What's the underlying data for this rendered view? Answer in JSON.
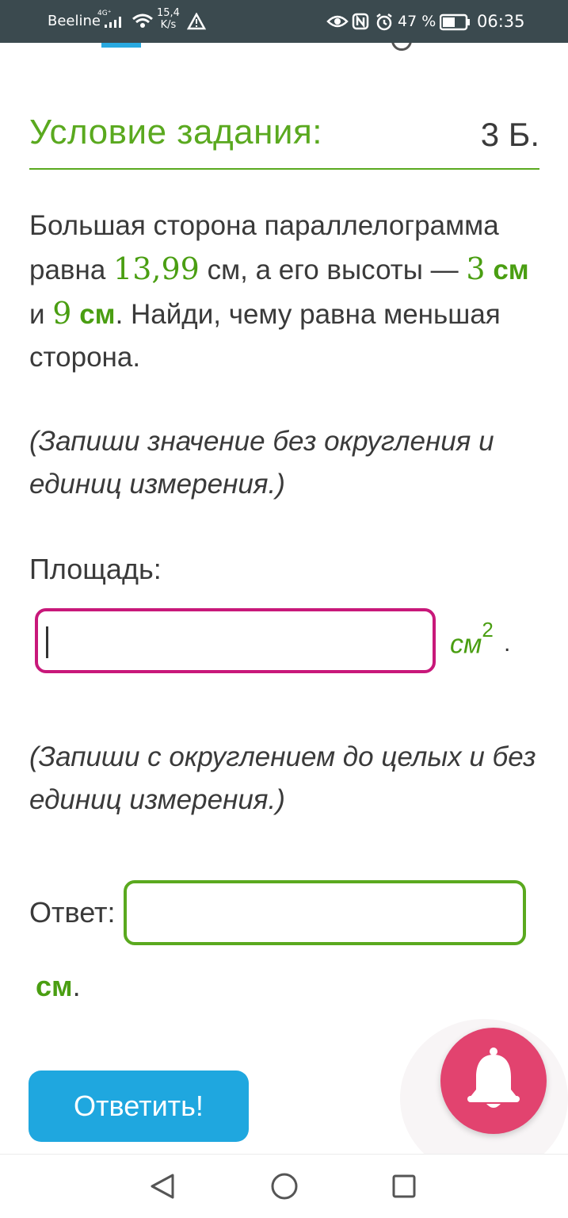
{
  "status_bar": {
    "carrier": "Beeline",
    "network_type": "4G⁺",
    "speed_value": "15,4",
    "speed_unit": "K/s",
    "battery_percent": "47 %",
    "time": "06:35",
    "icons": [
      "signal-icon",
      "wifi-icon",
      "warning-icon",
      "eye-icon",
      "nfc-icon",
      "alarm-icon",
      "battery-icon"
    ]
  },
  "task": {
    "title": "Условие задания:",
    "points": "3 Б.",
    "problem": {
      "part1": "Большая сторона параллелограмма равна ",
      "side": "13,99",
      "part2": " см, а его высоты — ",
      "h1": "3",
      "h1_unit": " см",
      "part3": " и ",
      "h2": "9",
      "h2_unit": " см",
      "part4": ". Найди, чему равна меньшая сторона."
    },
    "hint_area": "(Запиши значение без округления и единиц измерения.)",
    "area_label": "Площадь:",
    "area_input_value": "",
    "area_unit": "см",
    "area_unit_power": "2",
    "area_unit_dot": ".",
    "hint_answer": "(Запиши с округлением до целых и без единиц измерения.)",
    "answer_label": "Ответ:",
    "answer_input_value": "",
    "answer_unit": "см",
    "answer_unit_dot": "."
  },
  "actions": {
    "submit_label": "Ответить!"
  },
  "colors": {
    "accent_green": "#5aa91f",
    "area_input_border": "#c8187a",
    "submit_bg": "#1fa7df",
    "bell_bg": "#e2436f",
    "status_bar_bg": "#3b4a4f"
  },
  "nav_bar": {
    "icons": [
      "back-icon",
      "home-icon",
      "recent-apps-icon"
    ]
  }
}
